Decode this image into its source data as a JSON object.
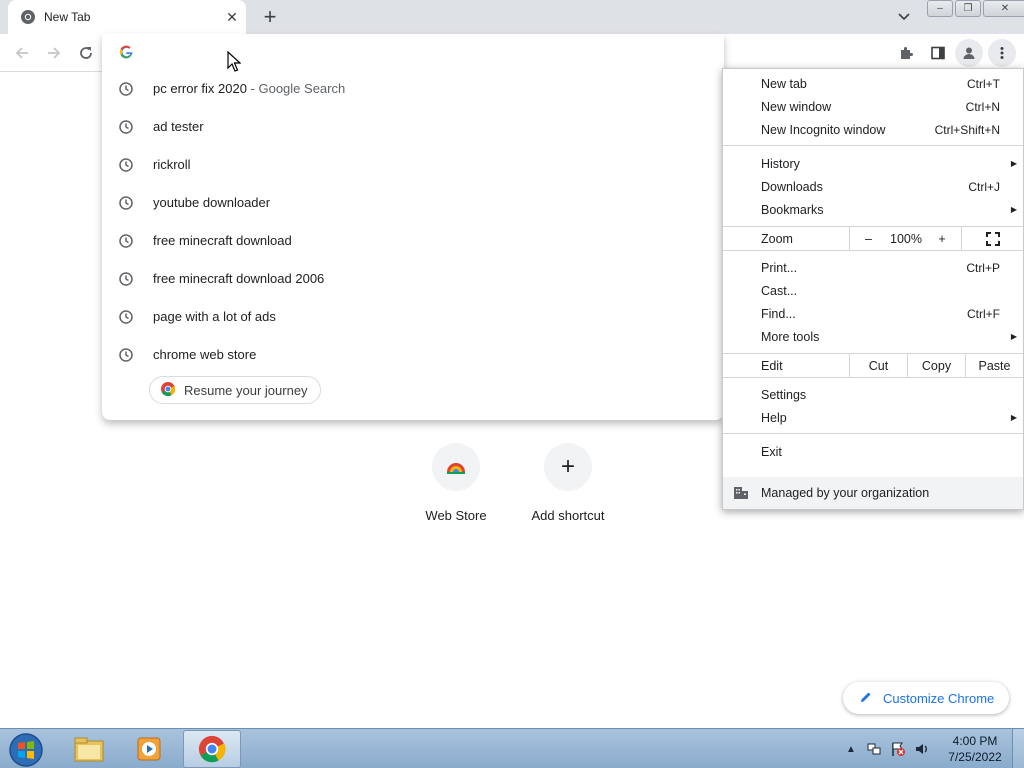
{
  "tab": {
    "title": "New Tab",
    "close_glyph": "✕"
  },
  "new_tab_glyph": "+",
  "window_buttons": {
    "minimize": "–",
    "restore": "❐",
    "close": "✕"
  },
  "omnibox": {
    "query": "",
    "suggestions": [
      {
        "text": "pc error fix 2020",
        "sub": " - Google Search"
      },
      {
        "text": "ad tester",
        "sub": ""
      },
      {
        "text": "rickroll",
        "sub": ""
      },
      {
        "text": "youtube downloader",
        "sub": ""
      },
      {
        "text": "free minecraft download",
        "sub": ""
      },
      {
        "text": "free minecraft download 2006",
        "sub": ""
      },
      {
        "text": "page with a lot of ads",
        "sub": ""
      },
      {
        "text": "chrome web store",
        "sub": ""
      }
    ],
    "resume_label": "Resume your journey"
  },
  "menu": {
    "new_tab": {
      "label": "New tab",
      "shortcut": "Ctrl+T"
    },
    "new_window": {
      "label": "New window",
      "shortcut": "Ctrl+N"
    },
    "new_incognito": {
      "label": "New Incognito window",
      "shortcut": "Ctrl+Shift+N"
    },
    "history": {
      "label": "History"
    },
    "downloads": {
      "label": "Downloads",
      "shortcut": "Ctrl+J"
    },
    "bookmarks": {
      "label": "Bookmarks"
    },
    "zoom": {
      "label": "Zoom",
      "minus": "–",
      "value": "100%",
      "plus": "+"
    },
    "print": {
      "label": "Print...",
      "shortcut": "Ctrl+P"
    },
    "cast": {
      "label": "Cast..."
    },
    "find": {
      "label": "Find...",
      "shortcut": "Ctrl+F"
    },
    "more_tools": {
      "label": "More tools"
    },
    "edit": {
      "label": "Edit",
      "cut": "Cut",
      "copy": "Copy",
      "paste": "Paste"
    },
    "settings": {
      "label": "Settings"
    },
    "help": {
      "label": "Help"
    },
    "exit": {
      "label": "Exit"
    },
    "managed": {
      "label": "Managed by your organization"
    },
    "submenu_arrow": "▶"
  },
  "shortcuts": [
    {
      "label": "Web Store"
    },
    {
      "label": "Add shortcut",
      "glyph": "+"
    }
  ],
  "customize_label": "Customize Chrome",
  "taskbar": {
    "time": "4:00 PM",
    "date": "7/25/2022",
    "tray_arrow": "▲"
  },
  "colors": {
    "accent": "#1a73e8",
    "chrome_red": "#db4437",
    "chrome_yellow": "#f4b400",
    "chrome_green": "#0f9d58"
  }
}
